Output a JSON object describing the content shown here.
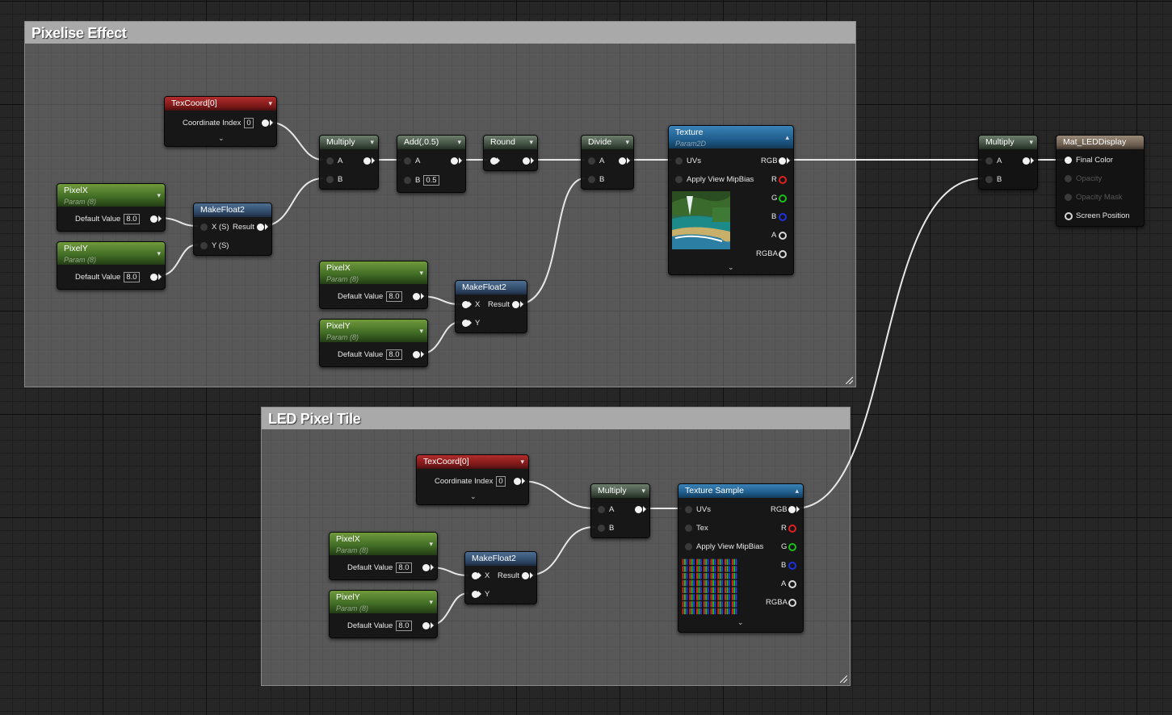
{
  "comments": {
    "pixelise": {
      "title": "Pixelise Effect"
    },
    "led": {
      "title": "LED Pixel Tile"
    }
  },
  "labels": {
    "coordinate_index": "Coordinate Index",
    "coordinate_index_value": "0",
    "default_value": "Default Value",
    "default_value_num": "8.0",
    "a": "A",
    "b": "B",
    "b_value": "0.5",
    "x": "X",
    "y": "Y",
    "xs": "X (S)",
    "ys": "Y (S)",
    "result": "Result",
    "uvs": "UVs",
    "tex": "Tex",
    "apply_mip": "Apply View MipBias",
    "rgb": "RGB",
    "r": "R",
    "g": "G",
    "bl": "B",
    "al": "A",
    "rgba": "RGBA",
    "param": "Param (8)",
    "param2d": "Param2D"
  },
  "nodes": {
    "texcoord": "TexCoord[0]",
    "multiply": "Multiply",
    "add": "Add(,0.5)",
    "round": "Round",
    "divide": "Divide",
    "texture": "Texture",
    "texture_sample": "Texture Sample",
    "pixelx": "PixelX",
    "pixely": "PixelY",
    "makefloat2": "MakeFloat2",
    "material": "Mat_LEDDisplay"
  },
  "material_pins": {
    "final_color": "Final Color",
    "opacity": "Opacity",
    "opacity_mask": "Opacity Mask",
    "screen_position": "Screen Position"
  },
  "icons": {
    "collapse": "chevron-down-icon",
    "expand": "chevron-up-icon",
    "resize": "resize-grip-icon"
  }
}
